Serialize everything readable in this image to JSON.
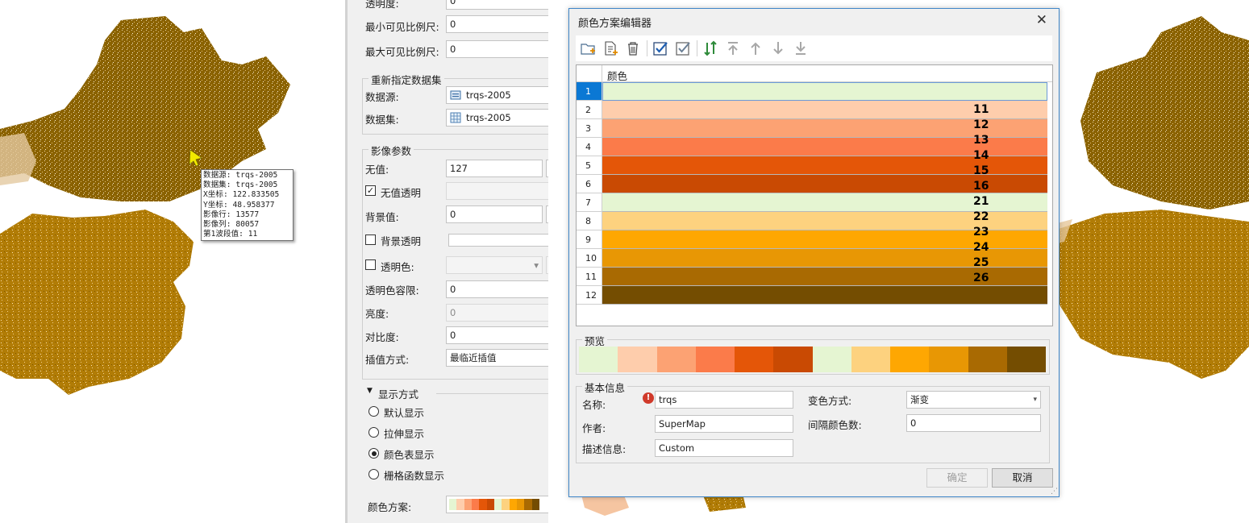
{
  "tooltip": {
    "lines": [
      "数据源: trqs-2005",
      "数据集: trqs-2005",
      "X坐标: 122.833505",
      "Y坐标: 48.958377",
      "影像行: 13577",
      "影像列: 80057",
      "第1波段值: 11"
    ]
  },
  "panel": {
    "top_cut_label": "透明度:",
    "top_cut_value": "0",
    "min_scale_label": "最小可见比例尺:",
    "min_scale_value": "0",
    "max_scale_label": "最大可见比例尺:",
    "max_scale_value": "0",
    "reassign_group": "重新指定数据集",
    "datasource_label": "数据源:",
    "datasource_value": "trqs-2005",
    "dataset_label": "数据集:",
    "dataset_value": "trqs-2005",
    "image_group": "影像参数",
    "nodata_label": "无值:",
    "nodata_value": "127",
    "nodata_transparent_label": "无值透明",
    "background_label": "背景值:",
    "background_value": "0",
    "background_transparent_label": "背景透明",
    "transparent_color_label": "透明色:",
    "transparent_tolerance_label": "透明色容限:",
    "transparent_tolerance_value": "0",
    "brightness_label": "亮度:",
    "brightness_value": "0",
    "contrast_label": "对比度:",
    "contrast_value": "0",
    "interp_label": "插值方式:",
    "interp_value": "最临近插值",
    "display_group": "显示方式",
    "radio_default": "默认显示",
    "radio_stretch": "拉伸显示",
    "radio_colortable": "颜色表显示",
    "radio_gridfunc": "栅格函数显示",
    "color_scheme_label": "颜色方案:"
  },
  "dialog": {
    "title": "颜色方案编辑器",
    "close": "✕",
    "grid_header": "颜色",
    "rows": [
      {
        "num": "1",
        "color": "#e5f5d2",
        "value": ""
      },
      {
        "num": "2",
        "color": "#fecdac",
        "value": "11"
      },
      {
        "num": "3",
        "color": "#fca273",
        "value": "12"
      },
      {
        "num": "4",
        "color": "#fb7b4a",
        "value": "13"
      },
      {
        "num": "5",
        "color": "#e45608",
        "value": "14"
      },
      {
        "num": "6",
        "color": "#c94a03",
        "value": "15"
      },
      {
        "num": "7",
        "color": "#e5f5d2",
        "value": "16"
      },
      {
        "num": "8",
        "color": "#fdd27f",
        "value": "21"
      },
      {
        "num": "9",
        "color": "#fea702",
        "value": "22"
      },
      {
        "num": "10",
        "color": "#e89704",
        "value": "23"
      },
      {
        "num": "11",
        "color": "#a96a02",
        "value": "24"
      },
      {
        "num": "12",
        "color": "#744d01",
        "value": "25"
      }
    ],
    "extra_value": "26",
    "preview_title": "预览",
    "info_title": "基本信息",
    "name_label": "名称:",
    "name_value": "trqs",
    "author_label": "作者:",
    "author_value": "SuperMap",
    "desc_label": "描述信息:",
    "desc_value": "Custom",
    "gradient_label": "变色方式:",
    "gradient_value": "渐变",
    "interval_label": "间隔颜色数:",
    "interval_value": "0",
    "ok_label": "确定",
    "cancel_label": "取消"
  },
  "colors": {
    "map_dark": "#8a6200",
    "map_mid": "#b07d05",
    "map_light": "#e8c488",
    "accent": "#0b78d4"
  }
}
